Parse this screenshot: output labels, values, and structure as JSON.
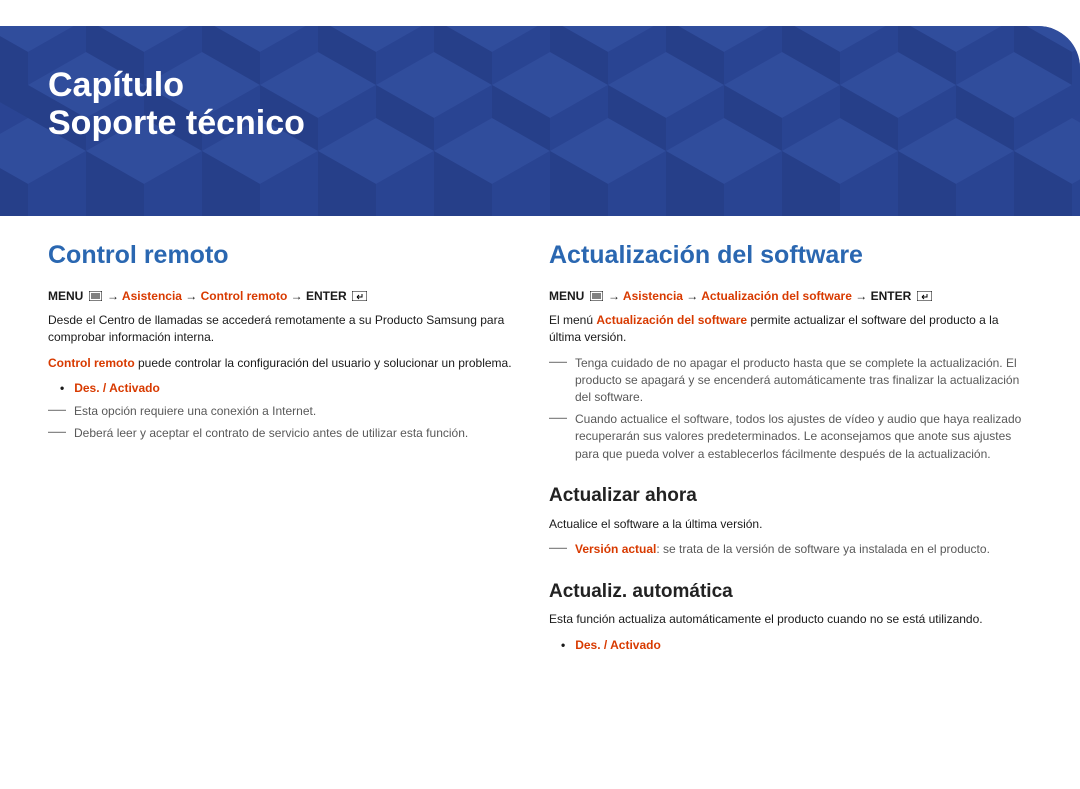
{
  "banner": {
    "chapter": "Capítulo",
    "title": "Soporte técnico"
  },
  "left": {
    "heading": "Control remoto",
    "breadcrumb": {
      "menu": "MENU",
      "arrow": "→",
      "step1": "Asistencia",
      "step2": "Control remoto",
      "enter": "ENTER"
    },
    "para1": "Desde el Centro de llamadas se accederá remotamente a su Producto Samsung para comprobar información interna.",
    "para2_lead": "Control remoto",
    "para2_rest": " puede controlar la configuración del usuario y solucionar un problema.",
    "option": "Des. / Activado",
    "note1": "Esta opción requiere una conexión a Internet.",
    "note2": "Deberá leer y aceptar el contrato de servicio antes de utilizar esta función."
  },
  "right": {
    "heading": "Actualización del software",
    "breadcrumb": {
      "menu": "MENU",
      "arrow": "→",
      "step1": "Asistencia",
      "step2": "Actualización del software",
      "enter": "ENTER"
    },
    "para1_a": "El menú ",
    "para1_lead": "Actualización del software",
    "para1_b": " permite actualizar el software del producto a la última versión.",
    "note1": "Tenga cuidado de no apagar el producto hasta que se complete la actualización. El producto se apagará y se encenderá automáticamente tras finalizar la actualización del software.",
    "note2": "Cuando actualice el software, todos los ajustes de vídeo y audio que haya realizado recuperarán sus valores predeterminados. Le aconsejamos que anote sus ajustes para que pueda volver a establecerlos fácilmente después de la actualización.",
    "sub1": {
      "heading": "Actualizar ahora",
      "para": "Actualice el software a la última versión.",
      "note_lead": "Versión actual",
      "note_rest": ": se trata de la versión de software ya instalada en el producto."
    },
    "sub2": {
      "heading": "Actualiz. automática",
      "para": "Esta función actualiza automáticamente el producto cuando no se está utilizando.",
      "option": "Des. / Activado"
    }
  }
}
